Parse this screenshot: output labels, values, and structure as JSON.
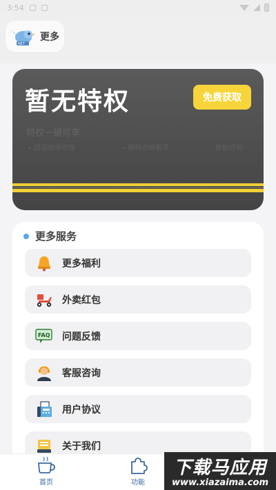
{
  "status_bar": {
    "time": "3:54"
  },
  "header": {
    "title": "更多"
  },
  "privilege_card": {
    "title": "暂无特权",
    "button_label": "免费获取",
    "subtitle": "特权一键可享",
    "features": [
      "• 赶调频率增强",
      "• 模特点映看享",
      "智能感知"
    ]
  },
  "services": {
    "heading": "更多服务",
    "items": [
      {
        "label": "更多福利",
        "icon": "bell-icon"
      },
      {
        "label": "外卖红包",
        "icon": "scooter-icon"
      },
      {
        "label": "问题反馈",
        "icon": "faq-icon"
      },
      {
        "label": "客服咨询",
        "icon": "support-agent-icon"
      },
      {
        "label": "用户协议",
        "icon": "fax-icon"
      },
      {
        "label": "关于我们",
        "icon": "about-icon"
      }
    ]
  },
  "bottom_nav": {
    "home_label": "首页",
    "function_label": "功能"
  },
  "watermark": {
    "cn": "下载马应用",
    "en": "www.xiazaima.com"
  },
  "colors": {
    "accent_yellow": "#f7d53a",
    "card_dark": "#4a4a4a",
    "dot_blue": "#5aa5ee"
  }
}
